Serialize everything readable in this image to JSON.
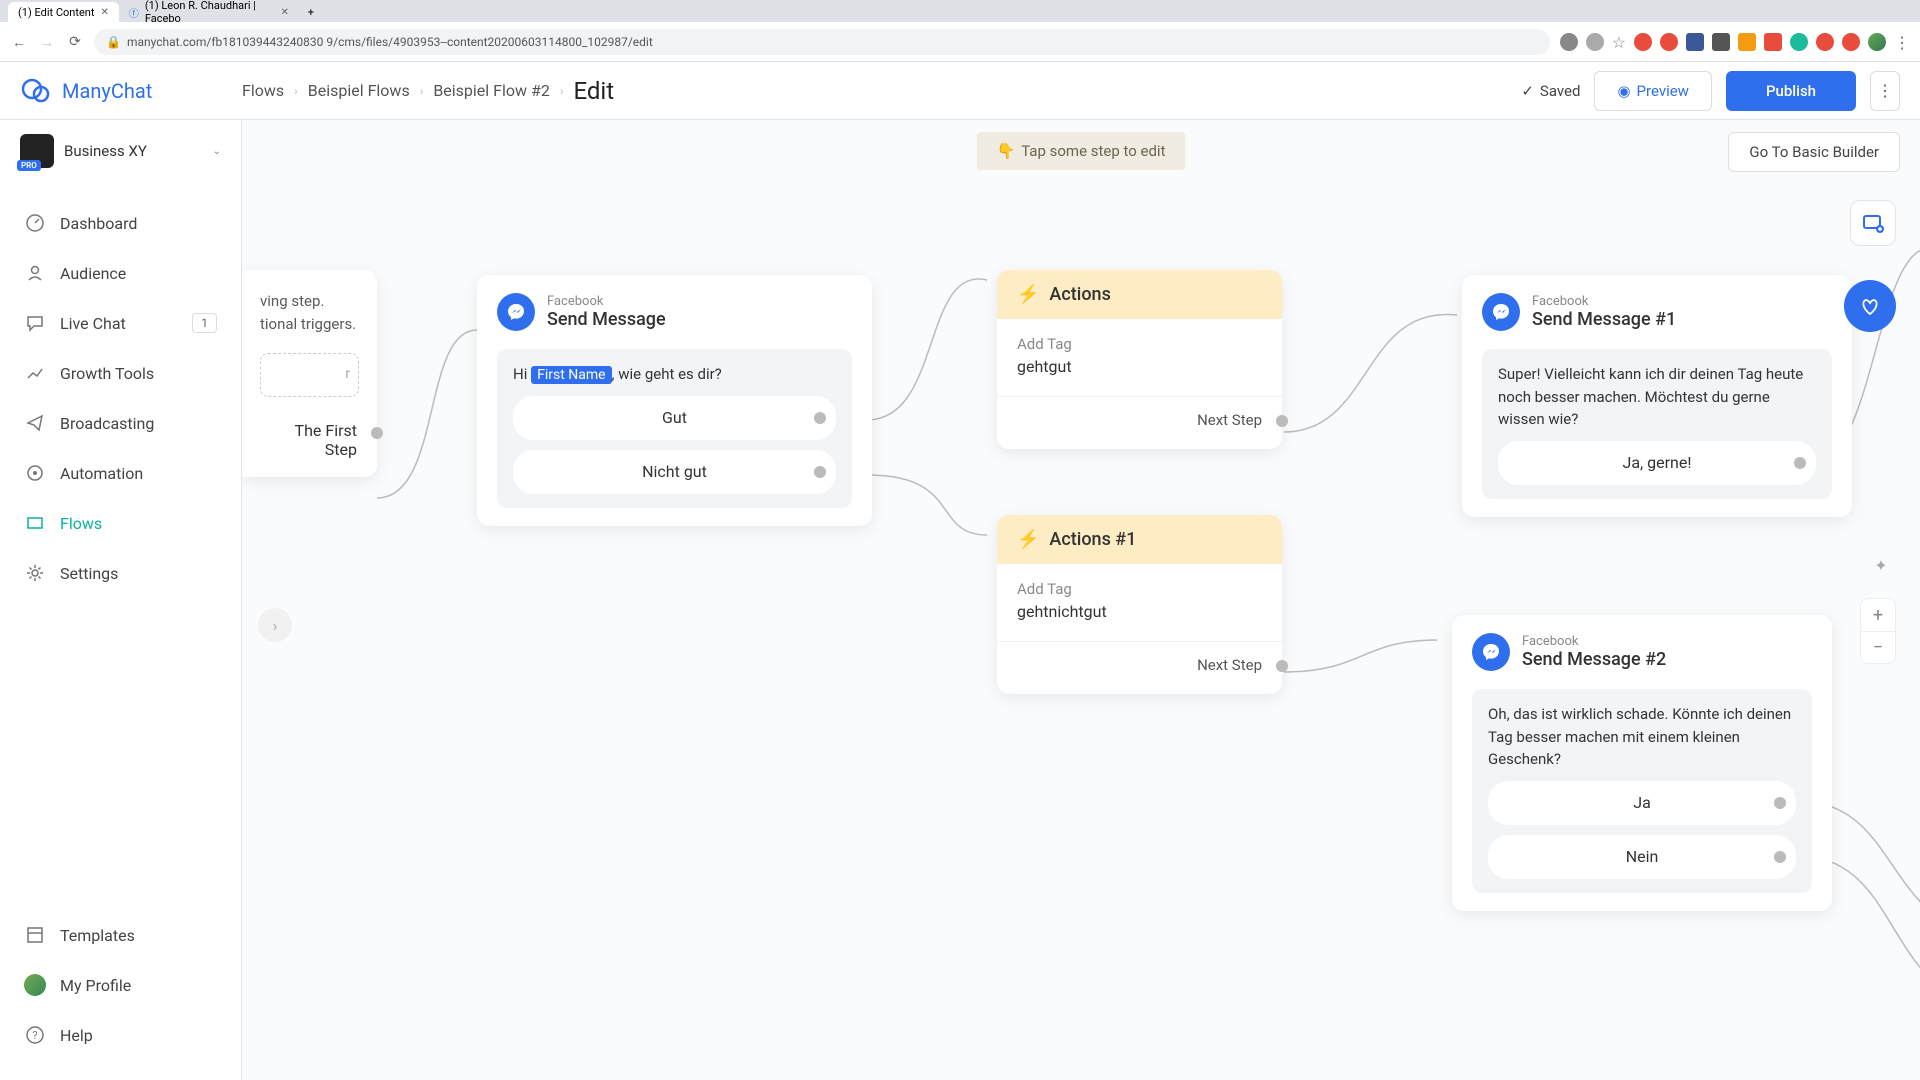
{
  "browser": {
    "tabs": [
      {
        "title": "(1) Edit Content",
        "active": true
      },
      {
        "title": "(1) Leon R. Chaudhari | Facebo",
        "active": false
      }
    ],
    "url": "manychat.com/fb181039443240830 9/cms/files/4903953--content20200603114800_102987/edit"
  },
  "logo": "ManyChat",
  "breadcrumb": {
    "items": [
      "Flows",
      "Beispiel Flows",
      "Beispiel Flow #2"
    ],
    "current": "Edit"
  },
  "header": {
    "saved": "Saved",
    "preview": "Preview",
    "publish": "Publish"
  },
  "workspace": {
    "name": "Business XY",
    "badge": "PRO"
  },
  "sidebar": {
    "items": [
      {
        "label": "Dashboard"
      },
      {
        "label": "Audience"
      },
      {
        "label": "Live Chat",
        "badge": "1"
      },
      {
        "label": "Growth Tools"
      },
      {
        "label": "Broadcasting"
      },
      {
        "label": "Automation"
      },
      {
        "label": "Flows",
        "active": true
      },
      {
        "label": "Settings"
      }
    ],
    "bottom": [
      {
        "label": "Templates"
      },
      {
        "label": "My Profile"
      },
      {
        "label": "Help"
      }
    ]
  },
  "canvas": {
    "hint": "Tap some step to edit",
    "basic_builder": "Go To Basic Builder"
  },
  "nodes": {
    "partial": {
      "text_line1": "ving step.",
      "text_line2": "tional triggers.",
      "first_step": "The First Step"
    },
    "send1": {
      "platform": "Facebook",
      "title": "Send Message",
      "msg_prefix": "Hi ",
      "var": "First Name",
      "msg_suffix": ", wie geht es dir?",
      "reply1": "Gut",
      "reply2": "Nicht gut"
    },
    "actions1": {
      "title": "Actions",
      "action": "Add Tag",
      "value": "gehtgut",
      "next": "Next Step"
    },
    "actions2": {
      "title": "Actions #1",
      "action": "Add Tag",
      "value": "gehtnichtgut",
      "next": "Next Step"
    },
    "send2": {
      "platform": "Facebook",
      "title": "Send Message #1",
      "msg": "Super! Vielleicht kann ich dir deinen Tag heute noch besser machen. Möchtest du gerne wissen wie?",
      "reply1": "Ja, gerne!"
    },
    "send3": {
      "platform": "Facebook",
      "title": "Send Message #2",
      "msg": "Oh, das ist wirklich schade. Könnte ich deinen Tag besser machen mit einem kleinen Geschenk?",
      "reply1": "Ja",
      "reply2": "Nein"
    }
  }
}
